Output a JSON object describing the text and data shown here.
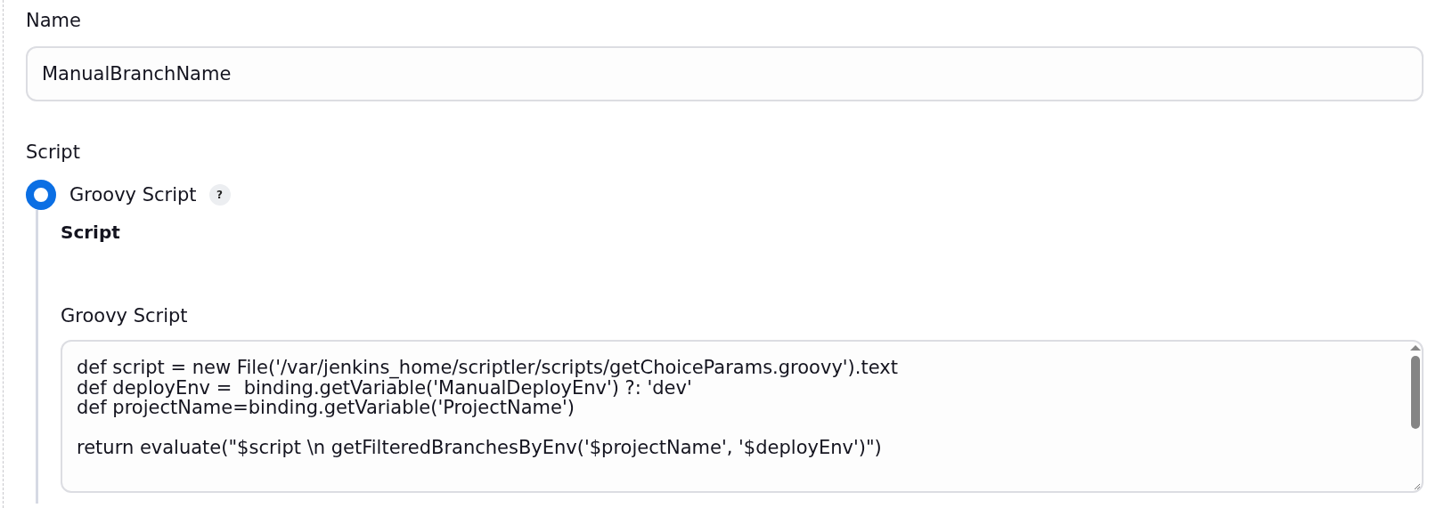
{
  "name_field": {
    "label": "Name",
    "value": "ManualBranchName"
  },
  "script_section": {
    "label": "Script",
    "options": [
      {
        "label": "Groovy Script",
        "selected": true,
        "help": "?"
      }
    ],
    "panel": {
      "heading": "Script",
      "field_label": "Groovy Script",
      "blocks": [
        [
          "def script = new File('/var/jenkins_home/scriptler/scripts/getChoiceParams.groovy').text",
          "def deployEnv =  binding.getVariable('ManualDeployEnv') ?: 'dev'",
          "def projectName=binding.getVariable('ProjectName')"
        ],
        [
          "return evaluate(\"$script \\n getFilteredBranchesByEnv('$projectName', '$deployEnv')\")"
        ]
      ]
    }
  }
}
